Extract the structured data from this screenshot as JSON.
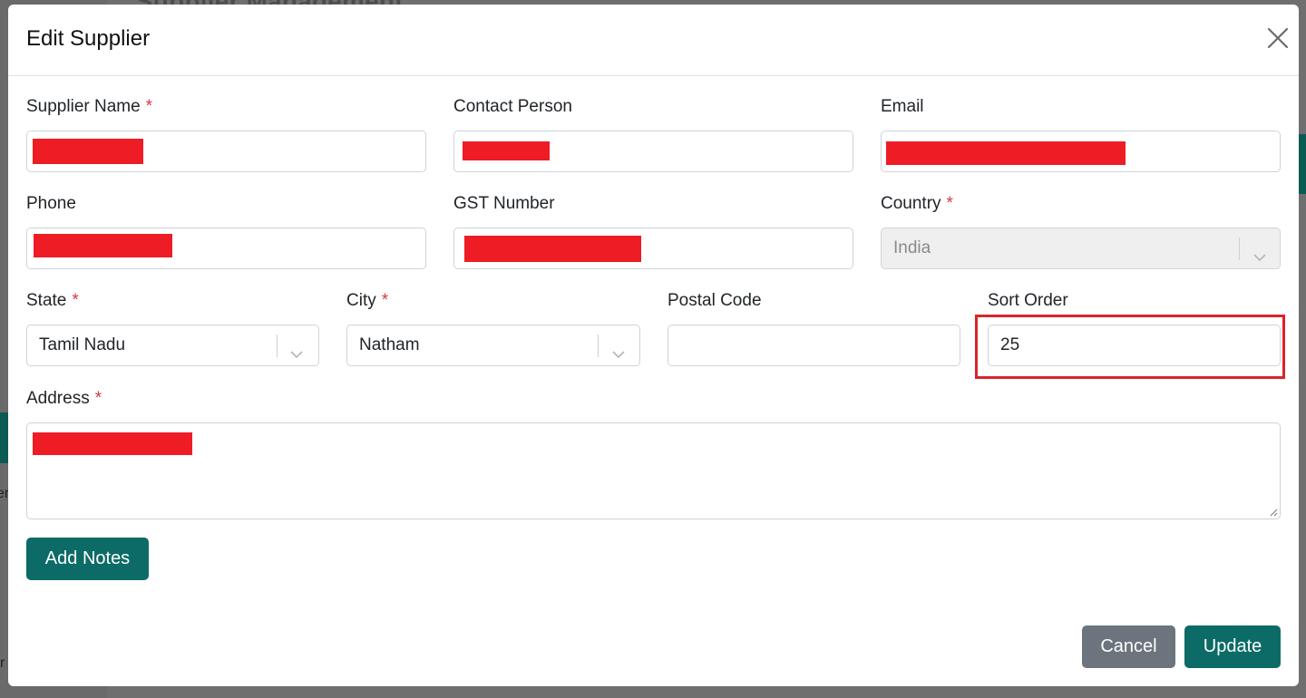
{
  "background": {
    "page_title": "Supplier Management",
    "frag_left_1": "er",
    "frag_left_2": "r"
  },
  "modal": {
    "title": "Edit Supplier",
    "close_icon": "close-icon"
  },
  "form": {
    "supplier_name": {
      "label": "Supplier Name",
      "required": "*",
      "value": ""
    },
    "contact_person": {
      "label": "Contact Person",
      "value": ""
    },
    "email": {
      "label": "Email",
      "value": ""
    },
    "phone": {
      "label": "Phone",
      "value": ""
    },
    "gst_number": {
      "label": "GST Number",
      "value": ""
    },
    "country": {
      "label": "Country",
      "required": "*",
      "value": "India",
      "disabled": true
    },
    "state": {
      "label": "State",
      "required": "*",
      "value": "Tamil Nadu"
    },
    "city": {
      "label": "City",
      "required": "*",
      "value": "Natham"
    },
    "postal_code": {
      "label": "Postal Code",
      "value": ""
    },
    "sort_order": {
      "label": "Sort Order",
      "value": "25"
    },
    "address": {
      "label": "Address",
      "required": "*",
      "value": ""
    }
  },
  "buttons": {
    "add_notes": "Add Notes",
    "cancel": "Cancel",
    "update": "Update"
  },
  "colors": {
    "primary": "#0c6b66",
    "secondary": "#6c757d",
    "required": "#dc3545",
    "highlight": "#d9252b",
    "redaction": "#ee1c25"
  }
}
